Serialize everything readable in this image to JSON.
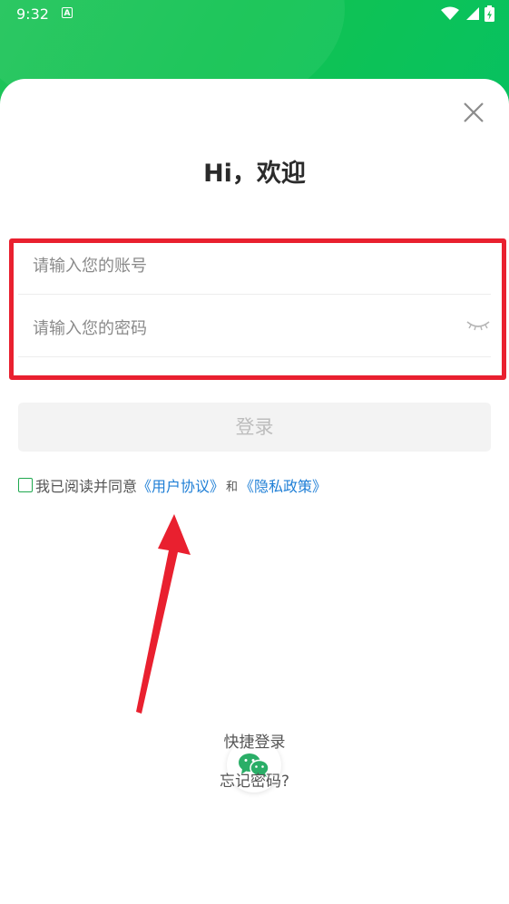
{
  "status_bar": {
    "time": "9:32",
    "notification_icon": "a-icon",
    "icons": [
      "wifi-icon",
      "signal-icon",
      "battery-charging-icon"
    ]
  },
  "theme": {
    "header_green": "#07c160",
    "highlight_red": "#e9202f",
    "link_blue": "#1f7fd6"
  },
  "sheet": {
    "close_icon": "close-icon",
    "title": "Hi，欢迎"
  },
  "form": {
    "account_placeholder": "请输入您的账号",
    "account_value": "",
    "password_placeholder": "请输入您的密码",
    "password_value": "",
    "eye_icon": "eye-closed-icon",
    "login_label": "登录"
  },
  "agreement": {
    "checked": false,
    "prefix": "我已阅读并同意",
    "user_agreement": "《用户协议》",
    "and": "和",
    "privacy_policy": "《隐私政策》"
  },
  "quick_login": {
    "icon": "wechat-icon",
    "label": "快捷登录",
    "forgot": "忘记密码?"
  }
}
